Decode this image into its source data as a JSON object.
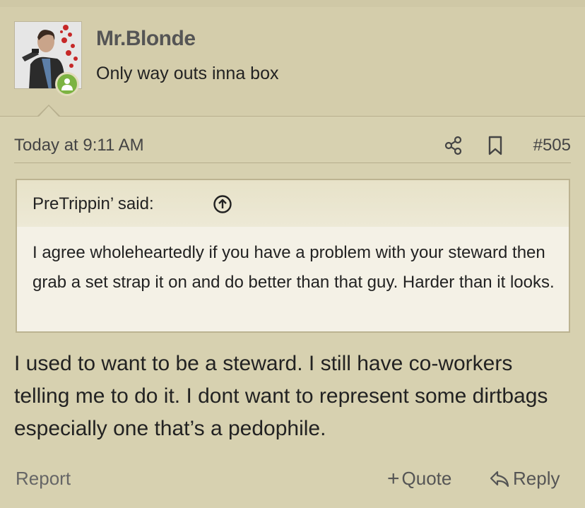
{
  "user": {
    "name": "Mr.Blonde",
    "title": "Only way outs inna box",
    "status_color": "#7cb342"
  },
  "post": {
    "date": "Today at 9:11 AM",
    "number": "#505",
    "body": "I used to want to be a steward. I still have co-workers telling me to do it. I dont want to represent some dirtbags especially one that’s a pedophile."
  },
  "quote": {
    "author_said": "PreTrippin’ said:",
    "text": "I agree wholeheartedly if you have a problem with your steward then grab a set strap it on and do better than that guy. Harder than it looks."
  },
  "actions": {
    "report": "Report",
    "quote": "Quote",
    "reply": "Reply"
  },
  "icons": {
    "share": "share-icon",
    "bookmark": "bookmark-icon",
    "quote_arrow": "arrow-up-circle-icon",
    "reply": "reply-icon",
    "online": "user-icon"
  }
}
